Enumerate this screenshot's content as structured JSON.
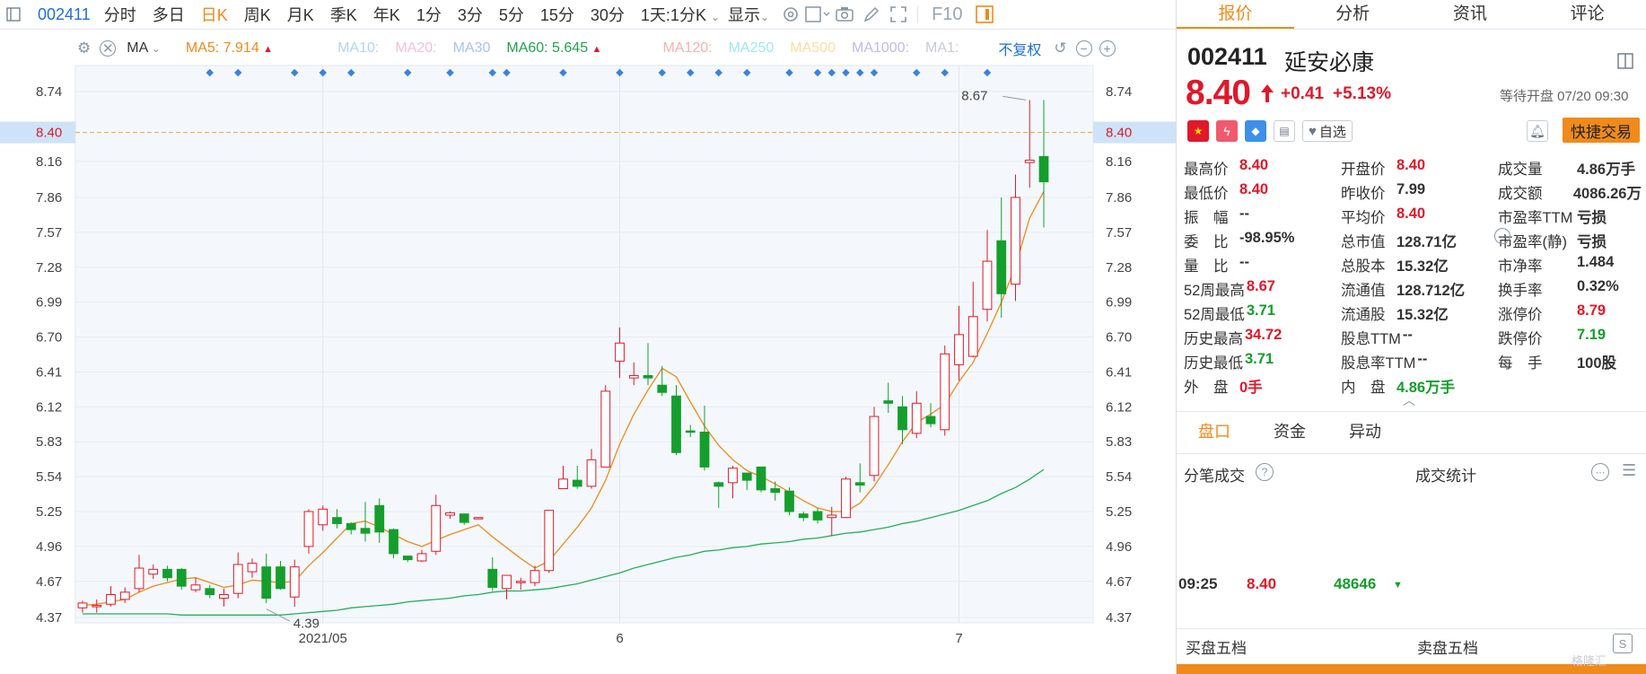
{
  "toolbar": {
    "sidebar_icon": "panel-icon",
    "code": "002411",
    "items": [
      "分时",
      "多日",
      "日K",
      "周K",
      "月K",
      "季K",
      "年K",
      "1分",
      "3分",
      "5分",
      "15分",
      "30分"
    ],
    "active": "日K",
    "period_dropdown": "1天:1分K",
    "display": "显示",
    "f10": "F10"
  },
  "mabar": {
    "ma_label": "MA",
    "ma5": "MA5: 7.914",
    "ma10": "MA10:",
    "ma20": "MA20:",
    "ma30": "MA30",
    "ma60": "MA60: 5.645",
    "ma120": "MA120:",
    "ma250": "MA250",
    "ma500": "MA500",
    "ma1000": "MA1000:",
    "ma1": "MA1:",
    "fq": "不复权"
  },
  "colors": {
    "up": "#e0182a",
    "down": "#149e2c",
    "ma5": "#f08a1a",
    "ma60": "#22b05a",
    "axis_highlight": "#cfe3f8",
    "accent": "#f08a1a"
  },
  "chart_data": {
    "type": "candlestick",
    "ylim": [
      4.23,
      8.89
    ],
    "yticks": [
      4.37,
      4.67,
      4.96,
      5.25,
      5.54,
      5.83,
      6.12,
      6.41,
      6.7,
      6.99,
      7.28,
      7.57,
      7.86,
      8.16,
      8.4,
      8.74
    ],
    "current_price_label": "8.40",
    "high_annotation": "8.67",
    "low_annotation": "4.39",
    "xlabels": [
      {
        "label": "2021/05",
        "index": 17
      },
      {
        "label": "6",
        "index": 38
      },
      {
        "label": "7",
        "index": 62
      }
    ],
    "candles": [
      [
        4.45,
        4.49,
        4.41,
        4.51
      ],
      [
        4.47,
        4.47,
        4.41,
        4.52
      ],
      [
        4.48,
        4.56,
        4.46,
        4.63
      ],
      [
        4.52,
        4.58,
        4.49,
        4.62
      ],
      [
        4.61,
        4.78,
        4.58,
        4.89
      ],
      [
        4.73,
        4.77,
        4.69,
        4.81
      ],
      [
        4.77,
        4.7,
        4.67,
        4.8
      ],
      [
        4.77,
        4.63,
        4.6,
        4.78
      ],
      [
        4.6,
        4.64,
        4.58,
        4.7
      ],
      [
        4.61,
        4.56,
        4.53,
        4.64
      ],
      [
        4.53,
        4.56,
        4.46,
        4.61
      ],
      [
        4.57,
        4.81,
        4.53,
        4.91
      ],
      [
        4.75,
        4.82,
        4.7,
        4.86
      ],
      [
        4.79,
        4.53,
        4.49,
        4.9
      ],
      [
        4.79,
        4.61,
        4.6,
        4.84
      ],
      [
        4.54,
        4.79,
        4.46,
        4.85
      ],
      [
        4.96,
        5.25,
        4.9,
        5.27
      ],
      [
        5.14,
        5.27,
        5.09,
        5.3
      ],
      [
        5.2,
        5.15,
        5.11,
        5.27
      ],
      [
        5.15,
        5.1,
        5.06,
        5.16
      ],
      [
        5.11,
        5.07,
        5.0,
        5.33
      ],
      [
        5.3,
        5.08,
        4.99,
        5.36
      ],
      [
        5.1,
        4.9,
        4.86,
        5.11
      ],
      [
        4.88,
        4.85,
        4.83,
        4.88
      ],
      [
        4.84,
        4.9,
        4.83,
        4.93
      ],
      [
        4.92,
        5.3,
        4.89,
        5.39
      ],
      [
        5.22,
        5.24,
        5.19,
        5.25
      ],
      [
        5.23,
        5.16,
        5.14,
        5.23
      ],
      [
        5.2,
        5.2,
        5.2,
        5.2
      ],
      [
        4.77,
        4.62,
        4.59,
        4.87
      ],
      [
        4.61,
        4.72,
        4.52,
        4.72
      ],
      [
        4.66,
        4.67,
        4.6,
        4.7
      ],
      [
        4.66,
        4.76,
        4.63,
        4.8
      ],
      [
        4.76,
        5.26,
        4.74,
        5.26
      ],
      [
        5.44,
        5.52,
        5.44,
        5.63
      ],
      [
        5.51,
        5.46,
        5.44,
        5.63
      ],
      [
        5.46,
        5.68,
        5.44,
        5.77
      ],
      [
        5.62,
        6.25,
        5.62,
        6.3
      ],
      [
        6.5,
        6.65,
        6.36,
        6.78
      ],
      [
        6.36,
        6.38,
        6.3,
        6.49
      ],
      [
        6.38,
        6.36,
        6.3,
        6.65
      ],
      [
        6.3,
        6.24,
        6.21,
        6.46
      ],
      [
        6.21,
        5.74,
        5.72,
        6.3
      ],
      [
        5.92,
        5.91,
        5.87,
        5.97
      ],
      [
        5.91,
        5.62,
        5.59,
        6.13
      ],
      [
        5.49,
        5.46,
        5.28,
        5.5
      ],
      [
        5.49,
        5.61,
        5.36,
        5.63
      ],
      [
        5.57,
        5.51,
        5.43,
        5.57
      ],
      [
        5.62,
        5.43,
        5.41,
        5.62
      ],
      [
        5.44,
        5.41,
        5.34,
        5.5
      ],
      [
        5.42,
        5.25,
        5.22,
        5.45
      ],
      [
        5.23,
        5.2,
        5.17,
        5.25
      ],
      [
        5.25,
        5.18,
        5.15,
        5.28
      ],
      [
        5.2,
        5.22,
        5.05,
        5.29
      ],
      [
        5.2,
        5.52,
        5.2,
        5.54
      ],
      [
        5.49,
        5.47,
        5.41,
        5.65
      ],
      [
        5.55,
        6.04,
        5.5,
        6.12
      ],
      [
        6.17,
        6.15,
        6.07,
        6.32
      ],
      [
        6.12,
        5.93,
        5.81,
        6.21
      ],
      [
        5.9,
        6.15,
        5.86,
        6.25
      ],
      [
        6.04,
        5.98,
        5.95,
        6.15
      ],
      [
        5.93,
        6.56,
        5.88,
        6.63
      ],
      [
        6.47,
        6.72,
        6.34,
        6.96
      ],
      [
        6.54,
        6.87,
        6.53,
        7.16
      ],
      [
        6.93,
        7.33,
        6.83,
        7.59
      ],
      [
        7.5,
        7.06,
        6.86,
        7.86
      ],
      [
        7.14,
        7.86,
        7.0,
        8.05
      ],
      [
        8.15,
        8.17,
        7.94,
        8.67
      ],
      [
        8.2,
        7.99,
        7.61,
        8.67
      ]
    ],
    "ma5": [
      4.47,
      4.48,
      4.5,
      4.52,
      4.58,
      4.63,
      4.66,
      4.69,
      4.7,
      4.66,
      4.62,
      4.64,
      4.68,
      4.67,
      4.66,
      4.67,
      4.8,
      4.91,
      5.03,
      5.15,
      5.17,
      5.12,
      5.06,
      5.0,
      4.96,
      5.01,
      5.06,
      5.1,
      5.14,
      5.04,
      4.95,
      4.86,
      4.78,
      4.84,
      4.98,
      5.12,
      5.28,
      5.51,
      5.81,
      6.06,
      6.26,
      6.44,
      6.37,
      6.16,
      5.96,
      5.8,
      5.68,
      5.59,
      5.54,
      5.48,
      5.41,
      5.34,
      5.28,
      5.25,
      5.25,
      5.32,
      5.46,
      5.64,
      5.83,
      5.99,
      6.06,
      6.14,
      6.33,
      6.49,
      6.73,
      6.99,
      7.29,
      7.69,
      7.91
    ],
    "ma60": [
      4.4,
      4.4,
      4.4,
      4.4,
      4.4,
      4.4,
      4.4,
      4.39,
      4.39,
      4.39,
      4.39,
      4.39,
      4.39,
      4.39,
      4.39,
      4.4,
      4.41,
      4.42,
      4.43,
      4.45,
      4.46,
      4.47,
      4.48,
      4.5,
      4.51,
      4.52,
      4.53,
      4.55,
      4.56,
      4.58,
      4.59,
      4.59,
      4.6,
      4.61,
      4.63,
      4.65,
      4.68,
      4.71,
      4.74,
      4.78,
      4.81,
      4.84,
      4.87,
      4.89,
      4.92,
      4.93,
      4.95,
      4.96,
      4.98,
      4.99,
      5.0,
      5.02,
      5.03,
      5.05,
      5.07,
      5.08,
      5.1,
      5.12,
      5.15,
      5.17,
      5.2,
      5.23,
      5.26,
      5.3,
      5.34,
      5.4,
      5.45,
      5.52,
      5.6
    ]
  },
  "quote": {
    "tabs": [
      "报价",
      "分析",
      "资讯",
      "评论"
    ],
    "active_tab": "报价",
    "code": "002411",
    "name": "延安必康",
    "price": "8.40",
    "change": "+0.41",
    "change_pct": "+5.13%",
    "status": "等待开盘 07/20 09:30",
    "watch_label": "自选",
    "quick_trade": "快捷交易",
    "fields": [
      [
        {
          "k": "最高价",
          "v": "8.40",
          "c": "red"
        },
        {
          "k": "开盘价",
          "v": "8.40",
          "c": "red"
        },
        {
          "k": "成交量",
          "v": "4.86万手",
          "c": "blk"
        }
      ],
      [
        {
          "k": "最低价",
          "v": "8.40",
          "c": "red"
        },
        {
          "k": "昨收价",
          "v": "7.99",
          "c": "blk"
        },
        {
          "k": "成交额",
          "v": "4086.26万",
          "c": "blk"
        }
      ],
      [
        {
          "k": "振　幅",
          "v": "--",
          "c": "blk"
        },
        {
          "k": "平均价",
          "v": "8.40",
          "c": "red"
        },
        {
          "k": "市盈率TTM",
          "v": "亏损",
          "c": "blk"
        }
      ],
      [
        {
          "k": "委　比",
          "v": "-98.95%",
          "c": "blk"
        },
        {
          "k": "总市值",
          "v": "128.71亿",
          "c": "blk"
        },
        {
          "k": "市盈率(静)",
          "v": "亏损",
          "c": "blk"
        }
      ],
      [
        {
          "k": "量　比",
          "v": "--",
          "c": "blk"
        },
        {
          "k": "总股本",
          "v": "15.32亿",
          "c": "blk"
        },
        {
          "k": "市净率",
          "v": "1.484",
          "c": "blk"
        }
      ],
      [
        {
          "k": "52周最高",
          "v": "8.67",
          "c": "red"
        },
        {
          "k": "流通值",
          "v": "128.712亿",
          "c": "blk"
        },
        {
          "k": "换手率",
          "v": "0.32%",
          "c": "blk"
        }
      ],
      [
        {
          "k": "52周最低",
          "v": "3.71",
          "c": "green"
        },
        {
          "k": "流通股",
          "v": "15.32亿",
          "c": "blk"
        },
        {
          "k": "涨停价",
          "v": "8.79",
          "c": "red"
        }
      ],
      [
        {
          "k": "历史最高",
          "v": "34.72",
          "c": "red"
        },
        {
          "k": "股息TTM",
          "v": "--",
          "c": "blk"
        },
        {
          "k": "跌停价",
          "v": "7.19",
          "c": "green"
        }
      ],
      [
        {
          "k": "历史最低",
          "v": "3.71",
          "c": "green"
        },
        {
          "k": "股息率TTM",
          "v": "--",
          "c": "blk"
        },
        {
          "k": "每　手",
          "v": "100股",
          "c": "blk"
        }
      ],
      [
        {
          "k": "外　盘",
          "v": "0手",
          "c": "red"
        },
        {
          "k": "内　盘",
          "v": "4.86万手",
          "c": "green"
        },
        {
          "k": "",
          "v": "",
          "c": "blk"
        }
      ]
    ],
    "subtabs": [
      "盘口",
      "资金",
      "异动"
    ],
    "active_subtab": "盘口",
    "tick_title": "分笔成交",
    "stats_title": "成交统计",
    "tick": {
      "time": "09:25",
      "price": "8.40",
      "vol": "48646"
    },
    "buy5": "买盘五档",
    "sell5": "卖盘五档",
    "watermark": "格隆汇"
  }
}
